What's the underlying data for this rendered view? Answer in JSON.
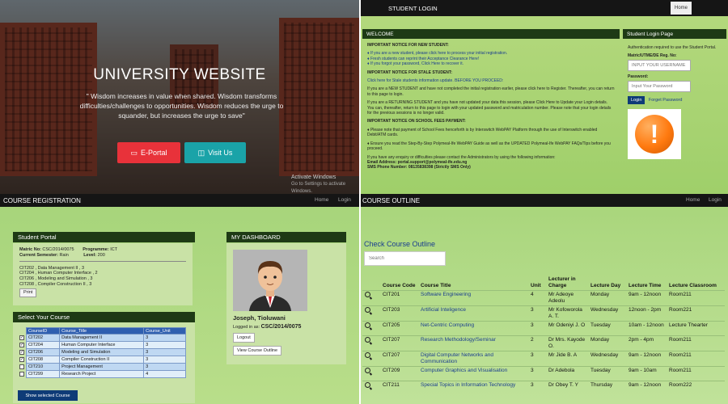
{
  "hero": {
    "title": "UNIVERSITY WEBSITE",
    "quote": "\" Wisdom increases in value when shared. Wisdom transforms difficulties/challenges to opportunities. Wisdom reduces the urge to squander, but increases the urge to save\"",
    "eportal_label": "E-Portal",
    "visit_label": "Visit Us",
    "activate_title": "Activate Windows",
    "activate_sub": "Go to Settings to activate Windows."
  },
  "login_page": {
    "bar_title": "STUDENT LOGIN",
    "home_tab": "Home",
    "welcome_header": "WELCOME",
    "new_notice_title": "IMPORTANT NOTICE FOR NEW STUDENT:",
    "new_items": [
      "♦ If you are a new student, please click here to process your initial registration.",
      "♦ Fresh students can reprint their Acceptance Clearance Here!",
      "♦ If you forgot your password, Click Here to recover it."
    ],
    "stale_notice_title": "IMPORTANT NOTICE FOR STALE STUDENT:",
    "stale_p1": "Click here for Stale students information update. BEFORE YOU PROCEED:",
    "stale_p2": "If you are a NEW STUDENT and have not completed the initial registration earlier, please click here to Register. Thereafter, you can return to this page to login.",
    "stale_p3": "If you are a RETURNING STUDENT and you have not updated your data this session, please Click Here to Update your Login details. You can, thereafter, return to this page to login with your updated password and matriculation number. Please note that your login details for the previous sessions is no longer valid.",
    "fees_title": "IMPORTANT NOTICE ON SCHOOL FEES PAYMENT:",
    "fees_p1": "♦ Please note that payment of School Fees henceforth is by Interswitch WebPAY Platform through the use of Interswitch enabled Debit/ATM cards.",
    "fees_p2": "♦ Ensure you read the Step-By-Step Polymeal-Ife WebPAY Guide as well as the UPDATED Polymeal-Ife WebPAY FAQs/Tips before you proceed.",
    "contact_p": "If you have any enquiry or difficulties please contact the Administrators by using the following information:",
    "email_line": "Email Address: portal.support@polymeal-ife.edu.ng",
    "sms_line": "SMS Phone Number: 08135838398 (Strictly SMS Only)",
    "login_header": "Student Login Page",
    "auth_note": "Authentication required to use the Student Portal.",
    "matric_label": "Matric/UTME/DE Reg. No:",
    "matric_placeholder": "INPUT YOUR USERNAME",
    "password_label": "Password:",
    "password_placeholder": "Input Your Password",
    "login_button": "Login",
    "forgot_link": "Forget Password"
  },
  "registration": {
    "bar_title": "COURSE REGISTRATION",
    "nav_home": "Home",
    "nav_login": "Login",
    "portal_header": "Student Portal",
    "matric_label": "Matric No:",
    "matric_value": "CSC/2014/0075",
    "programme_label": "Programme:",
    "programme_value": "ICT",
    "semester_label": "Current Semester:",
    "semester_value": "Rain",
    "level_label": "Level:",
    "level_value": "200",
    "registered": [
      "CIT202 , Data Management II , 3",
      "CIT204 , Human Computer Interface , 2",
      "CIT206 , Modeling and Simulation , 3",
      "CIT208 , Compiler Construction II , 3"
    ],
    "print_button": "Print",
    "select_header": "Select Your Course",
    "columns": [
      "CourseID",
      "Course_Title",
      "Course_Unit"
    ],
    "rows": [
      {
        "checked": "✓",
        "id": "CIT202",
        "title": "Data Management II",
        "unit": "3"
      },
      {
        "checked": "✓",
        "id": "CIT204",
        "title": "Human Computer Interface",
        "unit": "3"
      },
      {
        "checked": "✓",
        "id": "CIT206",
        "title": "Modeling and Simulation",
        "unit": "3"
      },
      {
        "checked": "✓",
        "id": "CIT208",
        "title": "Compiler Construction II",
        "unit": "3"
      },
      {
        "checked": "",
        "id": "CIT210",
        "title": "Project Management",
        "unit": "3"
      },
      {
        "checked": "",
        "id": "CIT299",
        "title": "Research Project",
        "unit": "4"
      }
    ],
    "show_button": "Show selected Course",
    "dashboard_header": "MY DASHBOARD",
    "student_name": "Joseph, Tioluwani",
    "logged_in_label": "Logged in as:",
    "logged_in_value": "CSC/2014/0075",
    "logout_button": "Logout",
    "outline_button": "View Course Outline"
  },
  "outline": {
    "bar_title": "COURSE OUTLINE",
    "nav_home": "Home",
    "nav_login": "Login",
    "page_title": "Check Course Outline",
    "search_placeholder": "Search",
    "columns": [
      "Course Code",
      "Course Title",
      "Unit",
      "Lecturer in Charge",
      "Lecture Day",
      "Lecture Time",
      "Lecture Classroom"
    ],
    "rows": [
      {
        "code": "CIT201",
        "title": "Software Engineering",
        "unit": "4",
        "lecturer": "Mr Adeoye Adeolu",
        "day": "Monday",
        "time": "9am - 12noon",
        "room": "Room211"
      },
      {
        "code": "CIT203",
        "title": "Artificial Inteligence",
        "unit": "3",
        "lecturer": "Mr Kofoworola A. T.",
        "day": "Wednesday",
        "time": "12noon - 2pm",
        "room": "Room221"
      },
      {
        "code": "CIT205",
        "title": "Net-Centric Computing",
        "unit": "3",
        "lecturer": "Mr Odeniyi J. O",
        "day": "Tuesday",
        "time": "10am - 12noon",
        "room": "Lecture Thearter"
      },
      {
        "code": "CIT207",
        "title": "Research Methodology/Seminar",
        "unit": "2",
        "lecturer": "Dr Mrs. Kayode O.",
        "day": "Monday",
        "time": "2pm - 4pm",
        "room": "Room211"
      },
      {
        "code": "CIT207",
        "title": "Digital Computer Networks and Communication",
        "unit": "3",
        "lecturer": "Mr Jide B. A",
        "day": "Wednesday",
        "time": "9am - 12noon",
        "room": "Room211"
      },
      {
        "code": "CIT209",
        "title": "Computer Graphics and Visualisation",
        "unit": "3",
        "lecturer": "Dr Adebola",
        "day": "Tuesday",
        "time": "9am - 10am",
        "room": "Room211"
      },
      {
        "code": "CIT211",
        "title": "Special Topics in Information Technology",
        "unit": "3",
        "lecturer": "Dr Obey T. Y",
        "day": "Thursday",
        "time": "9am - 12noon",
        "room": "Room222"
      }
    ]
  }
}
